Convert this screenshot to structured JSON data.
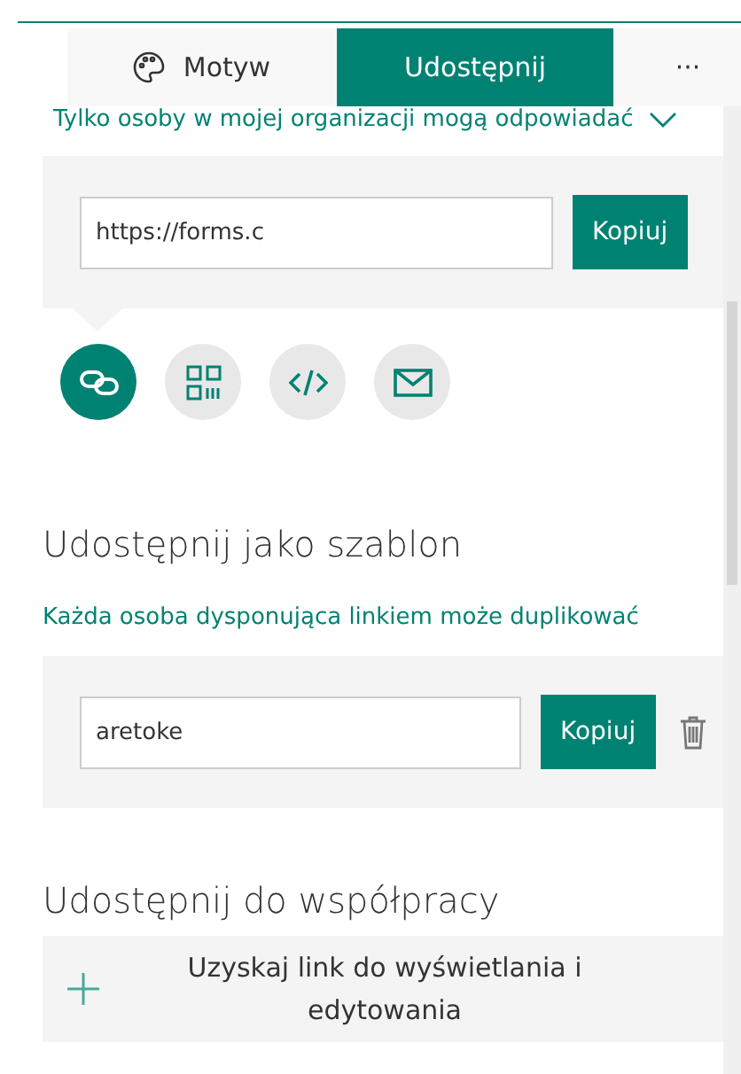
{
  "tabs": [
    {
      "label": "Motyw",
      "kind": "theme",
      "selected": false
    },
    {
      "label": "Udostępnij",
      "kind": "plain",
      "selected": true
    }
  ],
  "more_button": "···",
  "response_scope": "Tylko osoby w mojej organizacji mogą odpowiadać",
  "link_box": {
    "value": "https://forms.c",
    "copy_button": "Kopiuj"
  },
  "share_methods": [
    {
      "kind": "link",
      "selected": true
    },
    {
      "kind": "qr",
      "selected": false
    },
    {
      "kind": "embed",
      "selected": false
    },
    {
      "kind": "email",
      "selected": false
    }
  ],
  "template_section": {
    "heading": "Udostępnij jako szablon",
    "note": "Każda osoba dysponująca linkiem może duplikować",
    "value": "aretoke",
    "copy_button": "Kopiuj"
  },
  "collab_section": {
    "heading": "Udostępnij do współpracy",
    "button": "Uzyskaj link do wyświetlania i edytowania"
  }
}
